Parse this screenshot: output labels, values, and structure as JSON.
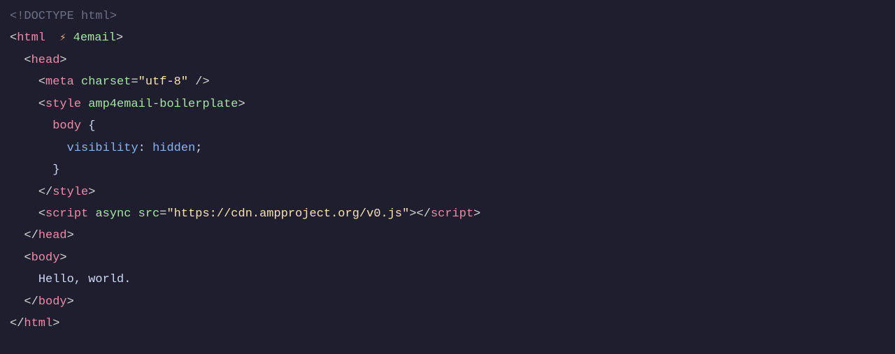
{
  "code": {
    "line1": {
      "doctype_open": "<!",
      "doctype_text": "DOCTYPE html",
      "doctype_close": ">"
    },
    "line2": {
      "open": "<",
      "tag": "html",
      "space": "  ",
      "lightning": "⚡",
      "attr": "4email",
      "close": ">"
    },
    "line3": {
      "indent": "  ",
      "open": "<",
      "tag": "head",
      "close": ">"
    },
    "line4": {
      "indent": "    ",
      "open": "<",
      "tag": "meta",
      "space": " ",
      "attr": "charset",
      "eq": "=",
      "quote1": "\"",
      "value": "utf-8",
      "quote2": "\"",
      "selfclose": " />"
    },
    "line5": {
      "indent": "    ",
      "open": "<",
      "tag": "style",
      "space": " ",
      "attr": "amp4email-boilerplate",
      "close": ">"
    },
    "line6": {
      "indent": "      ",
      "selector": "body",
      "space": " ",
      "brace": "{"
    },
    "line7": {
      "indent": "        ",
      "property": "visibility",
      "colon": ": ",
      "value": "hidden",
      "semi": ";"
    },
    "line8": {
      "indent": "      ",
      "brace": "}"
    },
    "line9": {
      "indent": "    ",
      "open": "</",
      "tag": "style",
      "close": ">"
    },
    "line10": {
      "indent": "    ",
      "open": "<",
      "tag": "script",
      "space1": " ",
      "attr1": "async",
      "space2": " ",
      "attr2": "src",
      "eq": "=",
      "quote1": "\"",
      "value": "https://cdn.ampproject.org/v0.js",
      "quote2": "\"",
      "close1": ">",
      "open2": "</",
      "tag2": "script",
      "close2": ">"
    },
    "line11": {
      "indent": "  ",
      "open": "</",
      "tag": "head",
      "close": ">"
    },
    "line12": {
      "indent": "  ",
      "open": "<",
      "tag": "body",
      "close": ">"
    },
    "line13": {
      "indent": "    ",
      "text": "Hello, world."
    },
    "line14": {
      "indent": "  ",
      "open": "</",
      "tag": "body",
      "close": ">"
    },
    "line15": {
      "open": "</",
      "tag": "html",
      "close": ">"
    }
  }
}
